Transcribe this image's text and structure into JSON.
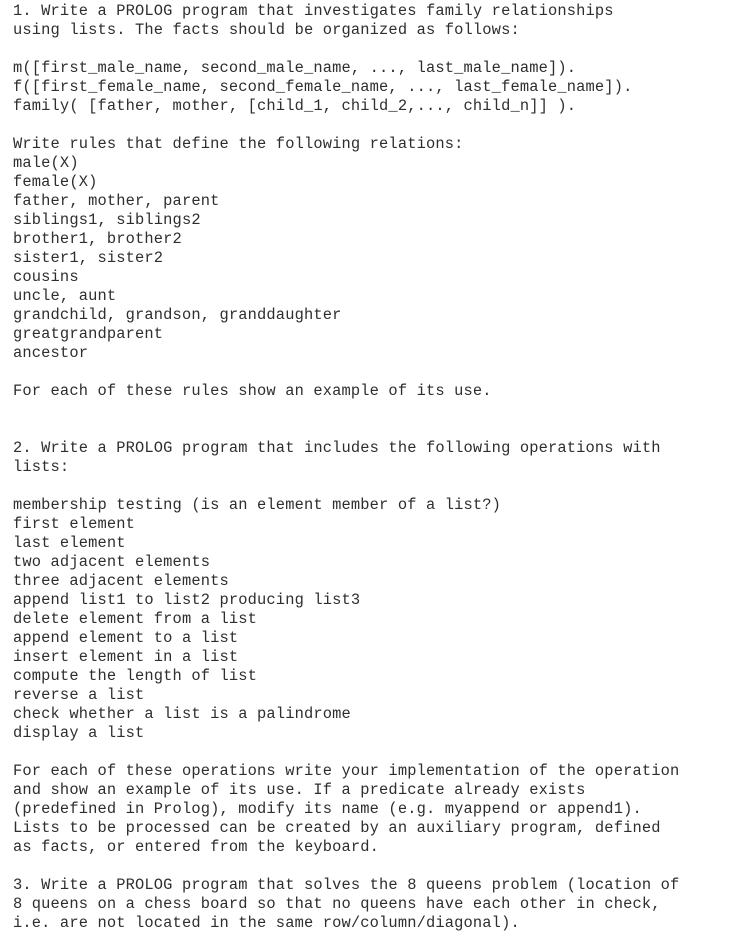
{
  "document": {
    "sections": [
      {
        "number": "1.",
        "intro_lines": [
          "1. Write a PROLOG program that investigates family relationships",
          "using lists. The facts should be organized as follows:"
        ],
        "code_lines": [
          "m([first_male_name, second_male_name, ..., last_male_name]).",
          "f([first_female_name, second_female_name, ..., last_female_name]).",
          "family( [father, mother, [child_1, child_2,..., child_n]] )."
        ],
        "rules_heading": "Write rules that define the following relations:",
        "relations": [
          "male(X)",
          "female(X)",
          "father, mother, parent",
          "siblings1, siblings2",
          "brother1, brother2",
          "sister1, sister2",
          "cousins",
          "uncle, aunt",
          "grandchild, grandson, granddaughter",
          "greatgrandparent",
          "ancestor"
        ],
        "closing": "For each of these rules show an example of its use."
      },
      {
        "number": "2.",
        "intro_lines": [
          "2. Write a PROLOG program that includes the following operations with",
          "lists:"
        ],
        "operations": [
          "membership testing (is an element member of a list?)",
          "first element",
          "last element",
          "two adjacent elements",
          "three adjacent elements",
          "append list1 to list2 producing list3",
          "delete element from a list",
          "append element to a list",
          "insert element in a list",
          "compute the length of list",
          "reverse a list",
          "check whether a list is a palindrome",
          "display a list"
        ],
        "closing_lines": [
          "For each of these operations write your implementation of the operation",
          "and show an example of its use. If a predicate already exists",
          "(predefined in Prolog), modify its name (e.g. myappend or append1).",
          "Lists to be processed can be created by an auxiliary program, defined",
          "as facts, or entered from the keyboard."
        ]
      },
      {
        "number": "3.",
        "intro_lines": [
          "3. Write a PROLOG program that solves the 8 queens problem (location of",
          "8 queens on a chess board so that no queens have each other in check,",
          "i.e. are not located in the same row/column/diagonal)."
        ]
      }
    ]
  }
}
